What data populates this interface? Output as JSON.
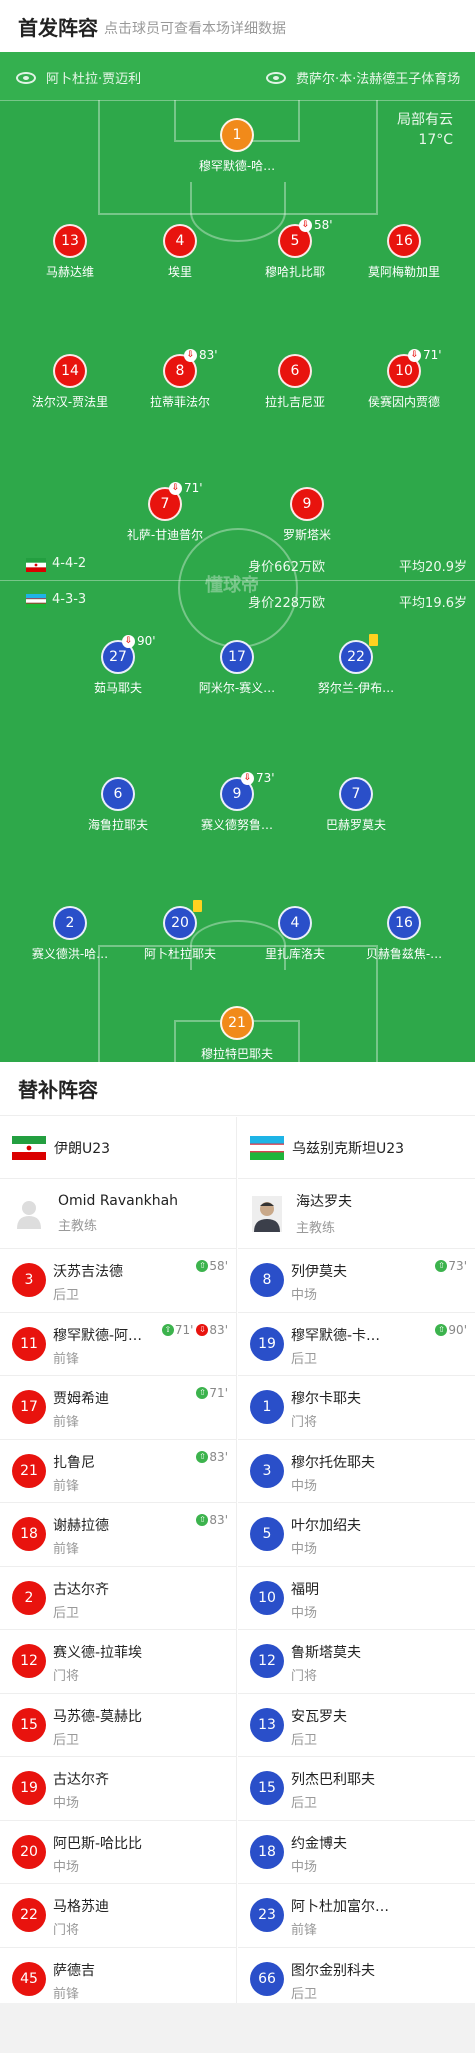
{
  "header": {
    "title": "首发阵容",
    "subtitle": "点击球员可查看本场详细数据"
  },
  "pitch": {
    "home_stadium": "阿卜杜拉·贾迈利",
    "away_stadium": "费萨尔·本·法赫德王子体育场",
    "weather": "局部有云",
    "temperature": "17°C",
    "watermark": "懂球帝",
    "home_summary": {
      "formation": "4-4-2",
      "value": "身价662万欧",
      "avg_age": "平均20.9岁"
    },
    "away_summary": {
      "formation": "4-3-3",
      "value": "身价228万欧",
      "avg_age": "平均19.6岁"
    }
  },
  "home_players": [
    {
      "num": "1",
      "name": "穆罕默德-哈…",
      "color": "orange",
      "event": ""
    },
    {
      "num": "13",
      "name": "马赫达维",
      "color": "red",
      "event": ""
    },
    {
      "num": "4",
      "name": "埃里",
      "color": "red",
      "event": ""
    },
    {
      "num": "5",
      "name": "穆哈扎比耶",
      "color": "red",
      "event": "58'"
    },
    {
      "num": "16",
      "name": "莫阿梅勒加里",
      "color": "red",
      "event": ""
    },
    {
      "num": "14",
      "name": "法尔汉-贾法里",
      "color": "red",
      "event": ""
    },
    {
      "num": "8",
      "name": "拉蒂菲法尔",
      "color": "red",
      "event": "83'"
    },
    {
      "num": "6",
      "name": "拉扎吉尼亚",
      "color": "red",
      "event": ""
    },
    {
      "num": "10",
      "name": "侯赛因内贾德",
      "color": "red",
      "event": "71'"
    },
    {
      "num": "7",
      "name": "礼萨-甘迪普尔",
      "color": "red",
      "event": "71'"
    },
    {
      "num": "9",
      "name": "罗斯塔米",
      "color": "red",
      "event": ""
    }
  ],
  "away_players": [
    {
      "num": "27",
      "name": "茹马耶夫",
      "color": "blue",
      "event": "90'"
    },
    {
      "num": "17",
      "name": "阿米尔-赛义…",
      "color": "blue",
      "event": ""
    },
    {
      "num": "22",
      "name": "努尔兰-伊布…",
      "color": "blue",
      "event": "yellow"
    },
    {
      "num": "6",
      "name": "海鲁拉耶夫",
      "color": "blue",
      "event": ""
    },
    {
      "num": "9",
      "name": "赛义德努鲁…",
      "color": "blue",
      "event": "73'"
    },
    {
      "num": "7",
      "name": "巴赫罗莫夫",
      "color": "blue",
      "event": ""
    },
    {
      "num": "2",
      "name": "赛义德洪-哈…",
      "color": "blue",
      "event": ""
    },
    {
      "num": "20",
      "name": "阿卜杜拉耶夫",
      "color": "blue",
      "event": "yellow"
    },
    {
      "num": "4",
      "name": "里扎库洛夫",
      "color": "blue",
      "event": ""
    },
    {
      "num": "16",
      "name": "贝赫鲁兹焦-…",
      "color": "blue",
      "event": ""
    },
    {
      "num": "21",
      "name": "穆拉特巴耶夫",
      "color": "orange",
      "event": ""
    }
  ],
  "subs": {
    "title": "替补阵容",
    "home": {
      "team": "伊朗U23",
      "coach": {
        "name": "Omid Ravankhah",
        "role": "主教练"
      },
      "players": [
        {
          "num": "3",
          "name": "沃苏吉法德",
          "pos": "后卫",
          "events": [
            {
              "type": "in",
              "min": "58'"
            }
          ]
        },
        {
          "num": "11",
          "name": "穆罕默德-阿…",
          "pos": "前锋",
          "events": [
            {
              "type": "in",
              "min": "71'"
            },
            {
              "type": "out",
              "min": "83'"
            }
          ]
        },
        {
          "num": "17",
          "name": "贾姆希迪",
          "pos": "前锋",
          "events": [
            {
              "type": "in",
              "min": "71'"
            }
          ]
        },
        {
          "num": "21",
          "name": "扎鲁尼",
          "pos": "前锋",
          "events": [
            {
              "type": "in",
              "min": "83'"
            }
          ]
        },
        {
          "num": "18",
          "name": "谢赫拉德",
          "pos": "前锋",
          "events": [
            {
              "type": "in",
              "min": "83'"
            }
          ]
        },
        {
          "num": "2",
          "name": "古达尔齐",
          "pos": "后卫",
          "events": []
        },
        {
          "num": "12",
          "name": "赛义德-拉菲埃",
          "pos": "门将",
          "events": []
        },
        {
          "num": "15",
          "name": "马苏德-莫赫比",
          "pos": "后卫",
          "events": []
        },
        {
          "num": "19",
          "name": "古达尔齐",
          "pos": "中场",
          "events": []
        },
        {
          "num": "20",
          "name": "阿巴斯-哈比比",
          "pos": "中场",
          "events": []
        },
        {
          "num": "22",
          "name": "马格苏迪",
          "pos": "门将",
          "events": []
        },
        {
          "num": "45",
          "name": "萨德吉",
          "pos": "前锋",
          "events": []
        }
      ]
    },
    "away": {
      "team": "乌兹别克斯坦U23",
      "coach": {
        "name": "海达罗夫",
        "role": "主教练"
      },
      "players": [
        {
          "num": "8",
          "name": "列伊莫夫",
          "pos": "中场",
          "events": [
            {
              "type": "in",
              "min": "73'"
            }
          ]
        },
        {
          "num": "19",
          "name": "穆罕默德-卡…",
          "pos": "后卫",
          "events": [
            {
              "type": "in",
              "min": "90'"
            }
          ]
        },
        {
          "num": "1",
          "name": "穆尔卡耶夫",
          "pos": "门将",
          "events": []
        },
        {
          "num": "3",
          "name": "穆尔托佐耶夫",
          "pos": "中场",
          "events": []
        },
        {
          "num": "5",
          "name": "叶尔加绍夫",
          "pos": "中场",
          "events": []
        },
        {
          "num": "10",
          "name": "福明",
          "pos": "中场",
          "events": []
        },
        {
          "num": "12",
          "name": "鲁斯塔莫夫",
          "pos": "门将",
          "events": []
        },
        {
          "num": "13",
          "name": "安瓦罗夫",
          "pos": "后卫",
          "events": []
        },
        {
          "num": "15",
          "name": "列杰巴利耶夫",
          "pos": "后卫",
          "events": []
        },
        {
          "num": "18",
          "name": "约金博夫",
          "pos": "中场",
          "events": []
        },
        {
          "num": "23",
          "name": "阿卜杜加富尔…",
          "pos": "前锋",
          "events": []
        },
        {
          "num": "66",
          "name": "图尔金别科夫",
          "pos": "后卫",
          "events": []
        }
      ]
    }
  }
}
